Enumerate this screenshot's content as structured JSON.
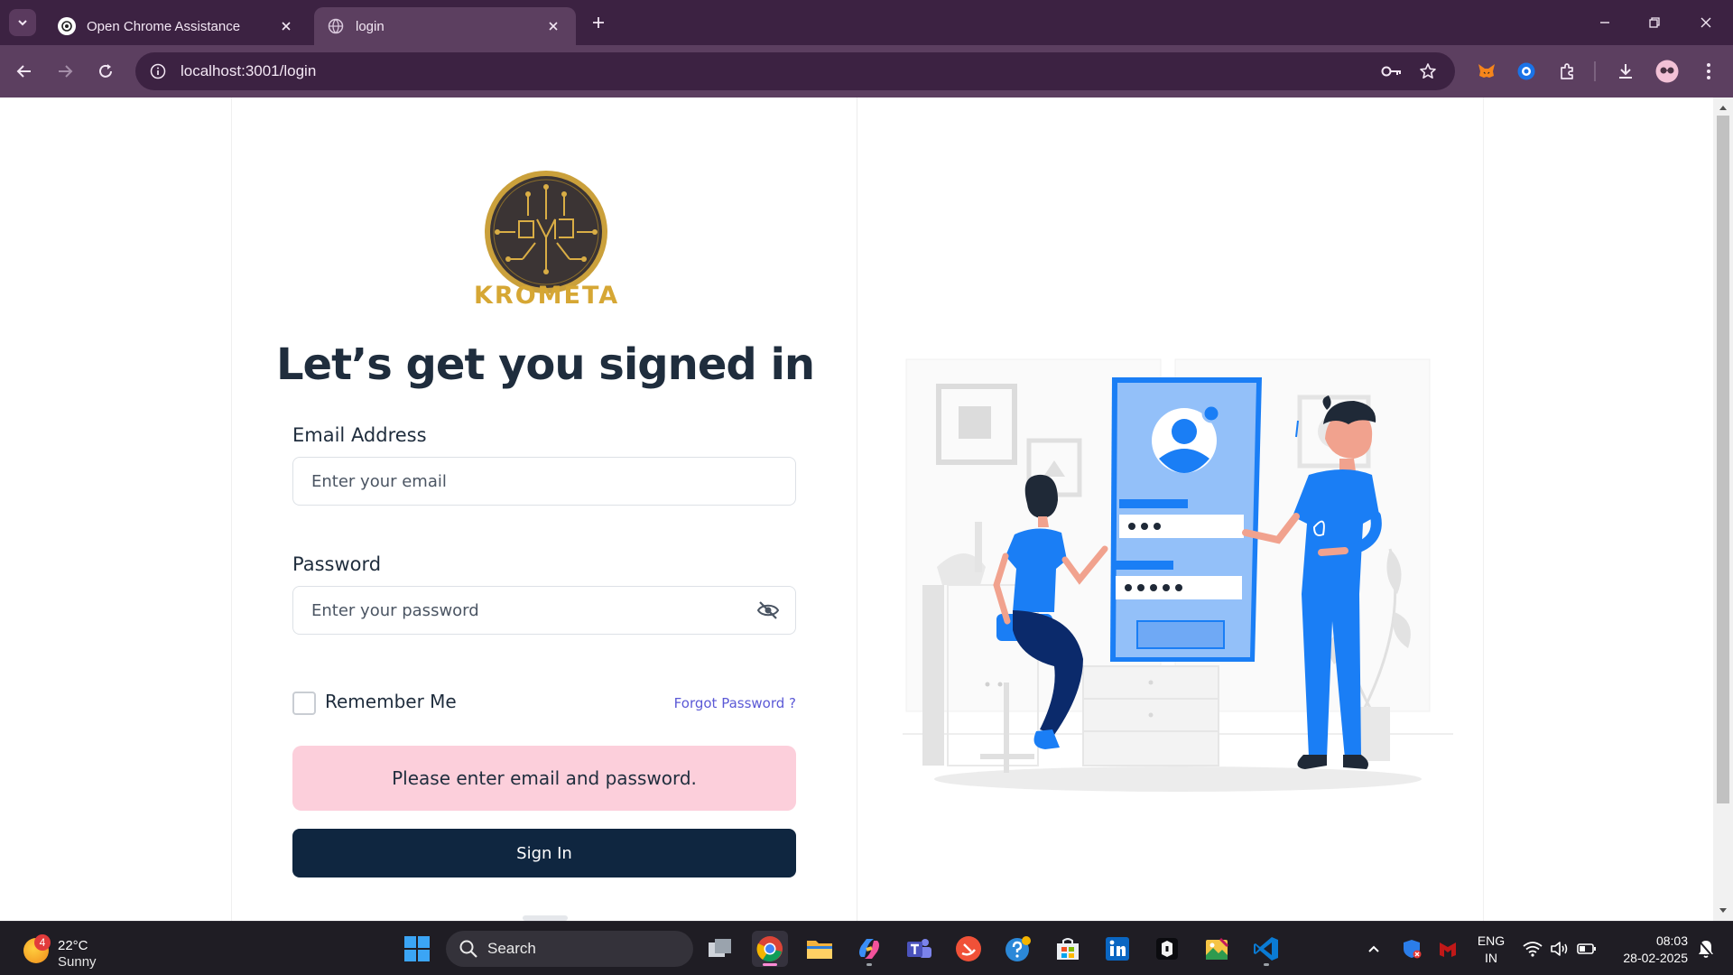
{
  "browser": {
    "tabs": [
      {
        "title": "Open Chrome Assistance",
        "active": false
      },
      {
        "title": "login",
        "active": true
      }
    ],
    "url": "localhost:3001/login"
  },
  "page": {
    "logo_text": "KROMETA",
    "heading": "Let’s get you signed in",
    "email": {
      "label": "Email Address",
      "placeholder": "Enter your email",
      "value": ""
    },
    "password": {
      "label": "Password",
      "placeholder": "Enter your password",
      "value": ""
    },
    "remember_label": "Remember Me",
    "remember_checked": false,
    "forgot_label": "Forgot Password ?",
    "error_message": "Please enter email and password.",
    "signin_label": "Sign In"
  },
  "taskbar": {
    "weather": {
      "temp": "22°C",
      "condition": "Sunny",
      "badge": "4"
    },
    "search_label": "Search",
    "apps": [
      "task-view",
      "chrome",
      "file-explorer",
      "copilot",
      "teams",
      "swift",
      "help",
      "microsoft-store",
      "linkedin",
      "terminal",
      "photo-editor",
      "vscode"
    ],
    "lang_line1": "ENG",
    "lang_line2": "IN",
    "time": "08:03",
    "date": "28-02-2025"
  },
  "colors": {
    "brand_gold": "#d6a734",
    "primary_navy": "#0f2640",
    "error_bg": "#fccfdb",
    "link": "#5b59d6",
    "illustration_blue": "#1a7ef5",
    "browser_frame": "#3c2242"
  }
}
